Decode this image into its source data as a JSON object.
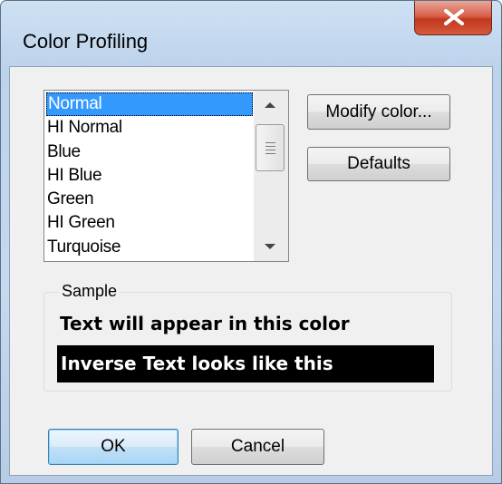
{
  "window": {
    "title": "Color Profiling",
    "close_icon": "close-icon"
  },
  "color_list": {
    "items": [
      "Normal",
      "HI Normal",
      "Blue",
      "HI Blue",
      "Green",
      "HI Green",
      "Turquoise"
    ],
    "selected": "Normal"
  },
  "buttons": {
    "modify": "Modify color...",
    "defaults": "Defaults",
    "ok": "OK",
    "cancel": "Cancel"
  },
  "sample": {
    "label": "Sample",
    "text": "Text will appear in this color",
    "inverse": "Inverse Text looks like this"
  },
  "colors": {
    "selection": "#3399ff",
    "close_button": "#c2371e",
    "inverse_bg": "#000000"
  }
}
